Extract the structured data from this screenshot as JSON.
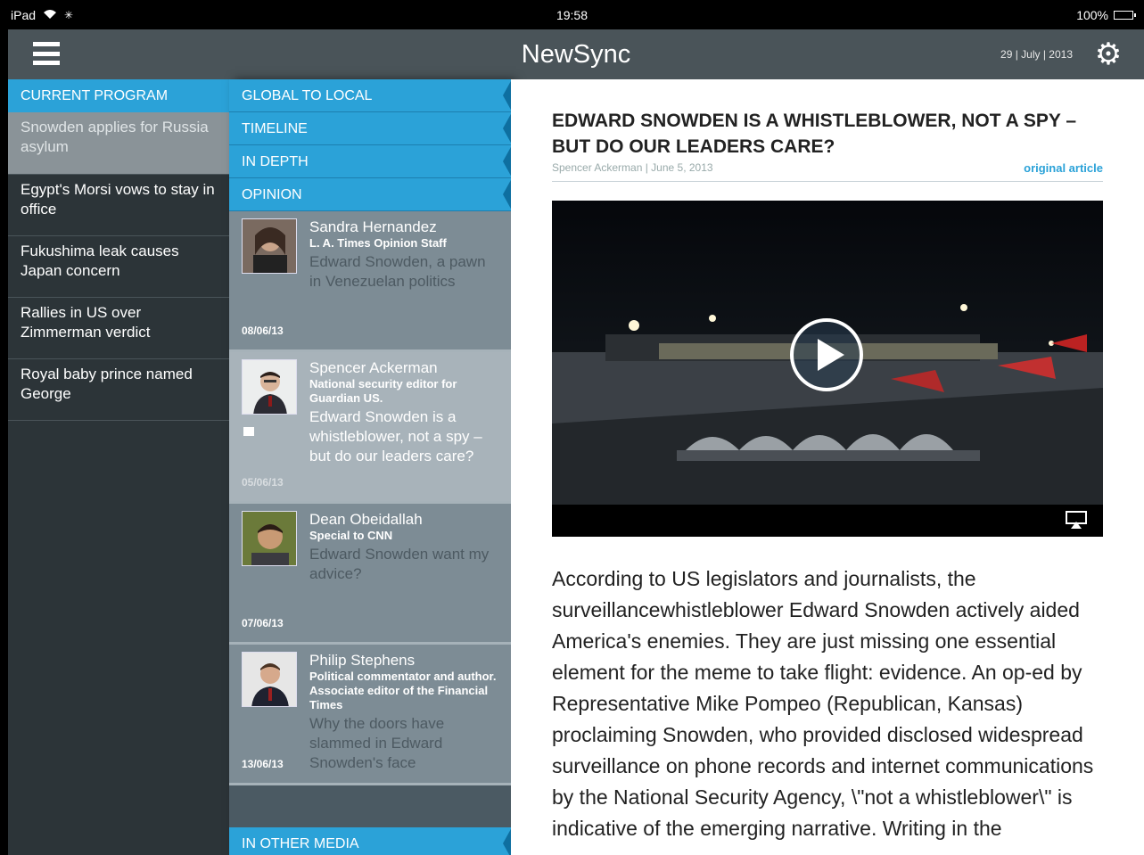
{
  "status_bar": {
    "device": "iPad",
    "time": "19:58",
    "battery": "100%"
  },
  "nav": {
    "title": "NewSync",
    "date": "29 | July | 2013"
  },
  "programs": {
    "header": "CURRENT PROGRAM",
    "items": [
      {
        "label": "Snowden applies for Russia asylum"
      },
      {
        "label": "Egypt's Morsi vows to stay in office"
      },
      {
        "label": "Fukushima leak causes Japan concern"
      },
      {
        "label": "Rallies in US over Zimmerman verdict"
      },
      {
        "label": "Royal baby prince named George"
      }
    ]
  },
  "sections": {
    "global": "GLOBAL TO LOCAL",
    "timeline": "TIMELINE",
    "in_depth": "IN DEPTH",
    "opinion": "OPINION",
    "other_media": "IN OTHER MEDIA"
  },
  "opinions": [
    {
      "author": "Sandra Hernandez",
      "role": "L. A. Times Opinion Staff",
      "headline": "Edward Snowden, a pawn in Venezuelan politics",
      "date": "08/06/13"
    },
    {
      "author": "Spencer Ackerman",
      "role": "National security editor for Guardian US.",
      "headline": "Edward Snowden is a whistleblower, not a spy – but do our leaders care?",
      "date": "05/06/13"
    },
    {
      "author": "Dean Obeidallah",
      "role": "Special to CNN",
      "headline": "Edward Snowden want my advice?",
      "date": "07/06/13"
    },
    {
      "author": "Philip Stephens",
      "role": "Political commentator and author. Associate editor of the Financial Times",
      "headline": "Why the doors have slammed in Edward Snowden's face",
      "date": "13/06/13"
    }
  ],
  "article": {
    "title": "EDWARD SNOWDEN IS A WHISTLEBLOWER, NOT A SPY – BUT DO OUR LEADERS CARE?",
    "byline": "Spencer Ackerman | June 5, 2013",
    "original_link": "original article",
    "body": "According to US legislators and journalists, the surveillancewhistleblower Edward Snowden actively aided America's enemies. They are just missing one essential element for the meme to take flight: evidence. An op-ed by Representative Mike Pompeo (Republican, Kansas) proclaiming Snowden, who provided disclosed widespread surveillance on phone records and internet communications by the National Security Agency, \\\"not a whistleblower\\\" is indicative of the emerging narrative. Writing in the"
  },
  "colors": {
    "accent": "#2ba2d8",
    "nav_bg": "#4a5459",
    "left_bg": "#2c3438",
    "card_bg": "#7d8c95"
  }
}
